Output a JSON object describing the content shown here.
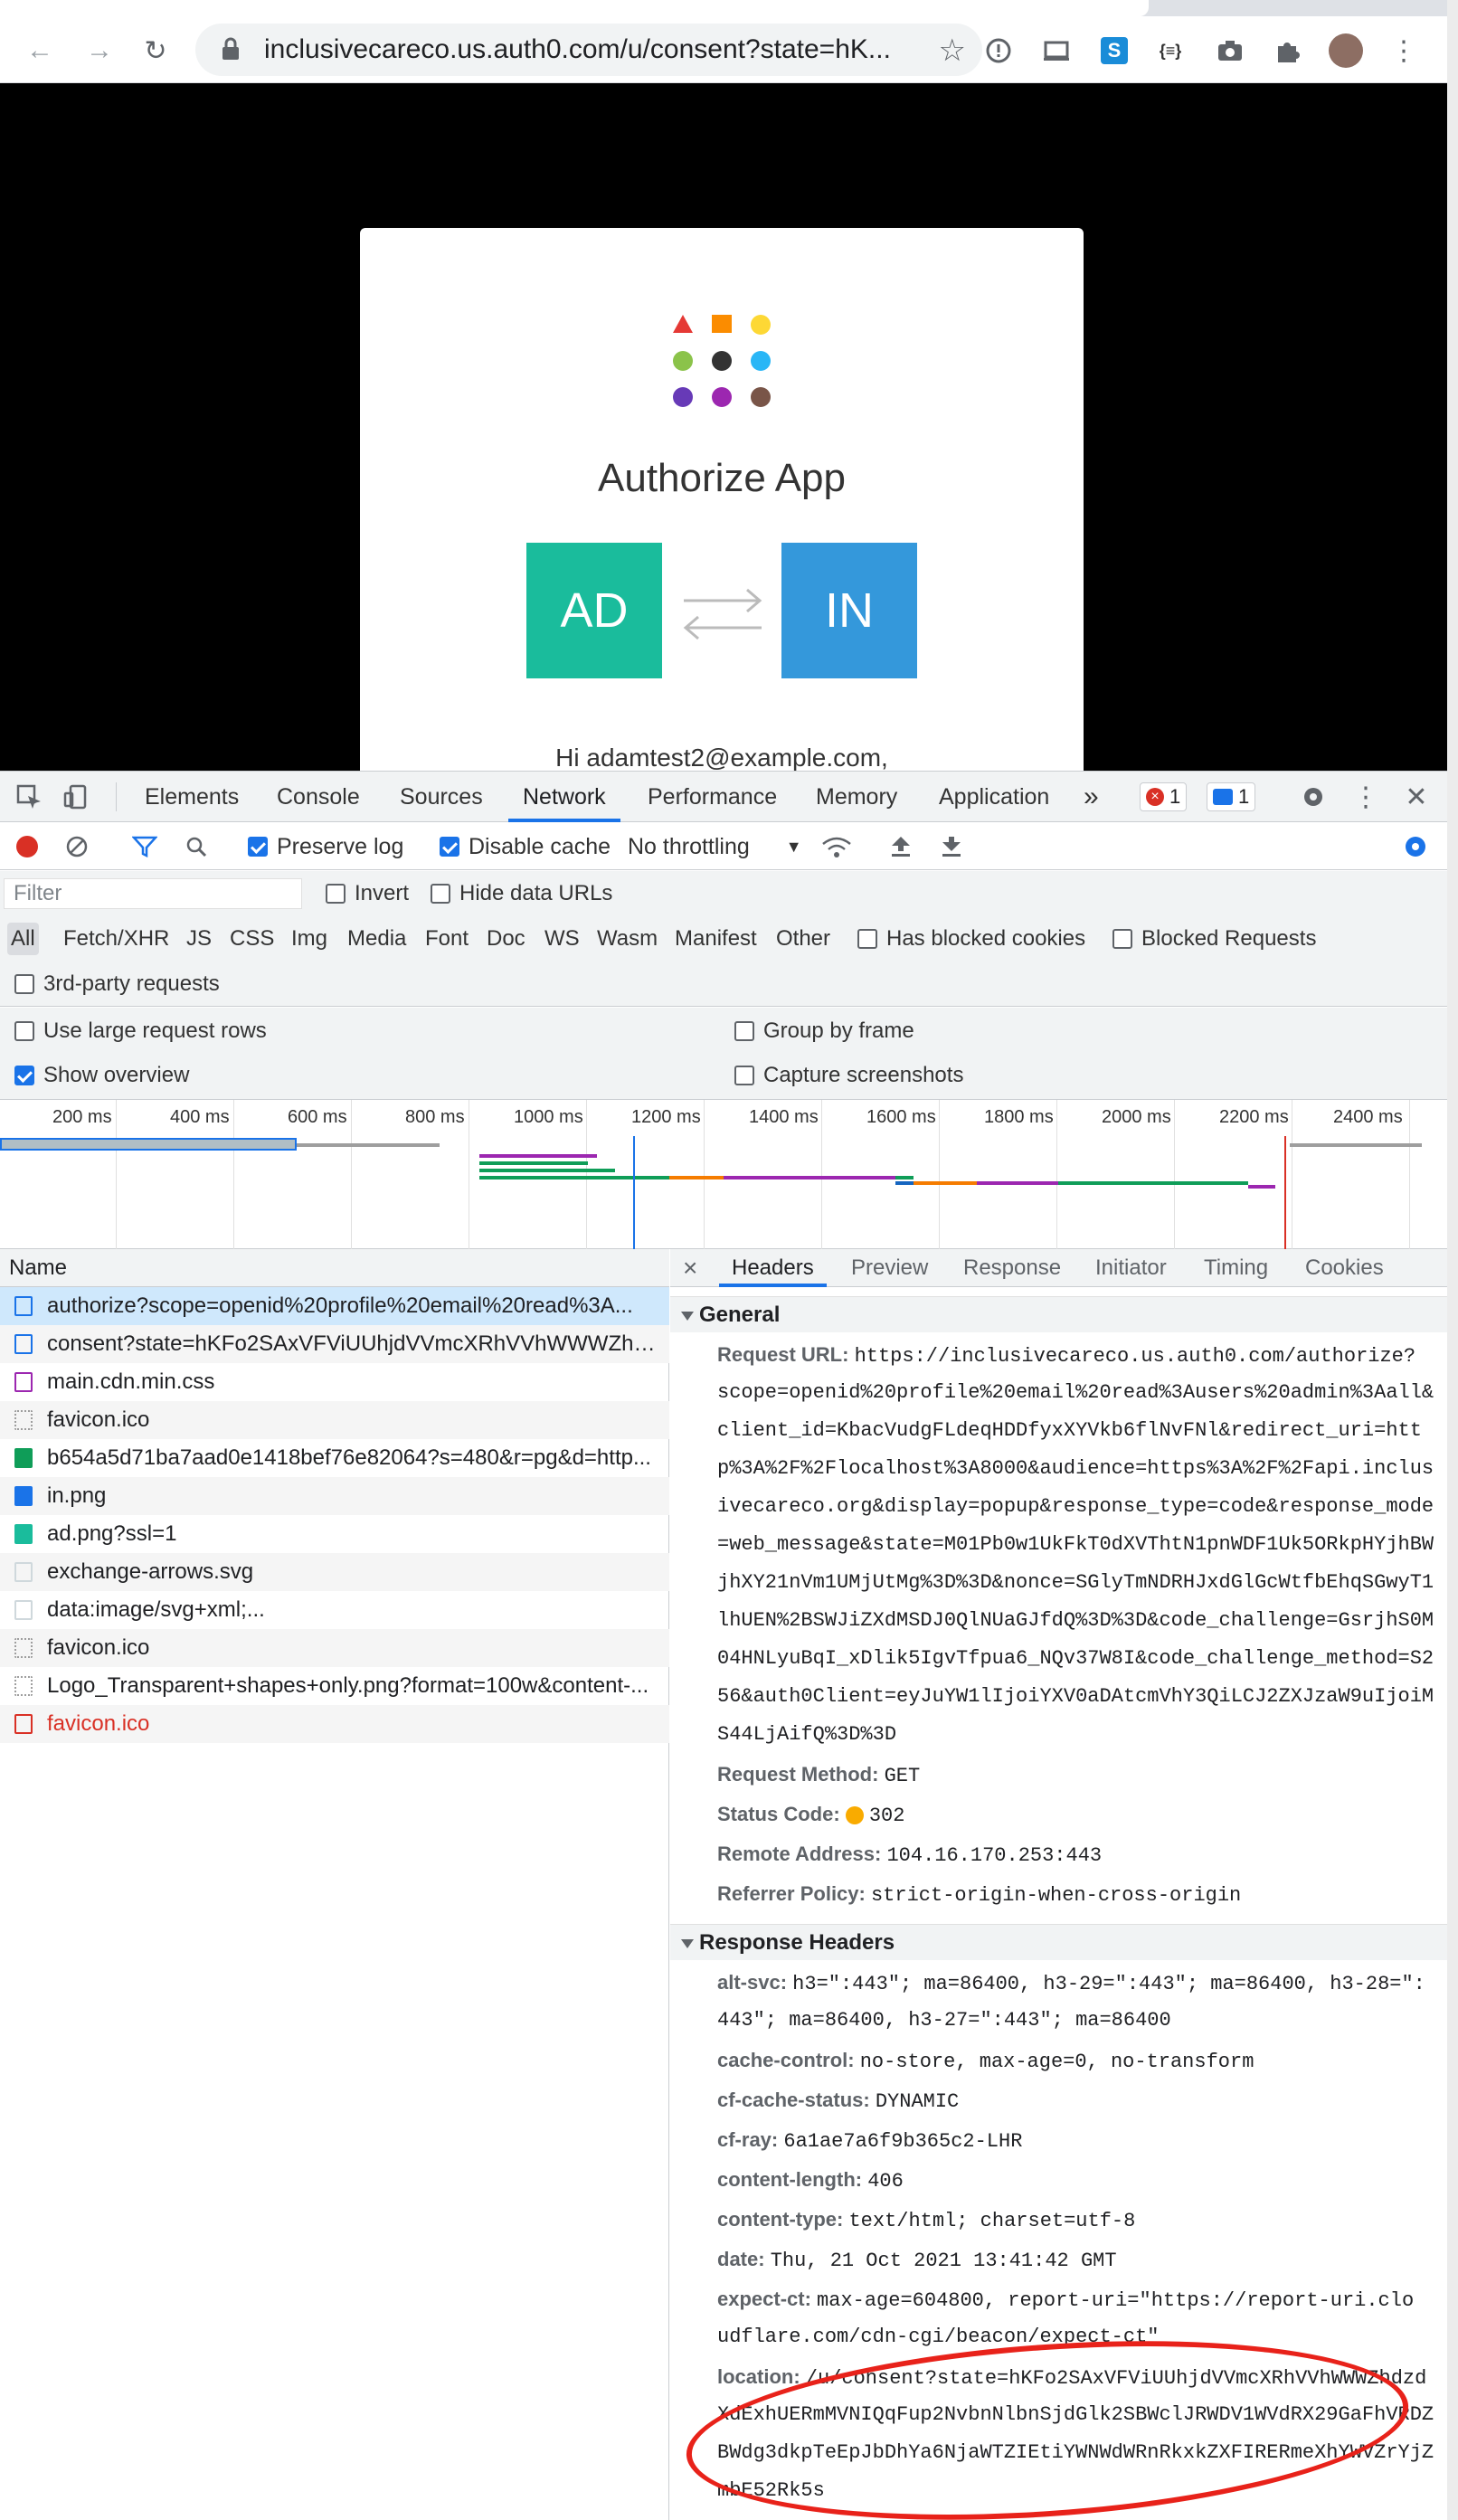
{
  "browser": {
    "url": "inclusivecareco.us.auth0.com/u/consent?state=hK...",
    "ext_label": "{≡}"
  },
  "page": {
    "title": "Authorize App",
    "tile_left": "AD",
    "tile_right": "IN",
    "greeting": "Hi adamtest2@example.com,",
    "tile_left_color": "#1abc9c",
    "tile_right_color": "#3498db"
  },
  "devtools": {
    "tabs": [
      "Elements",
      "Console",
      "Sources",
      "Network",
      "Performance",
      "Memory",
      "Application"
    ],
    "active_tab": "Network",
    "more_tabs": "»",
    "error_count": "1",
    "message_count": "1",
    "toolbar": {
      "preserve_log": "Preserve log",
      "disable_cache": "Disable cache",
      "throttling": "No throttling"
    },
    "filter": {
      "placeholder": "Filter",
      "invert": "Invert",
      "hide_data_urls": "Hide data URLs",
      "types": [
        "All",
        "Fetch/XHR",
        "JS",
        "CSS",
        "Img",
        "Media",
        "Font",
        "Doc",
        "WS",
        "Wasm",
        "Manifest",
        "Other"
      ],
      "has_blocked_cookies": "Has blocked cookies",
      "blocked_requests": "Blocked Requests",
      "third_party": "3rd-party requests"
    },
    "options": {
      "large_rows": "Use large request rows",
      "group_by_frame": "Group by frame",
      "show_overview": "Show overview",
      "capture_screenshots": "Capture screenshots"
    },
    "timeline_ticks": [
      "200 ms",
      "400 ms",
      "600 ms",
      "800 ms",
      "1000 ms",
      "1200 ms",
      "1400 ms",
      "1600 ms",
      "1800 ms",
      "2000 ms",
      "2200 ms",
      "2400 ms"
    ],
    "list": {
      "header": "Name",
      "rows": [
        "authorize?scope=openid%20profile%20email%20read%3A...",
        "consent?state=hKFo2SAxVFViUUhjdVVmcXRhVVhWWWZhd...",
        "main.cdn.min.css",
        "favicon.ico",
        "b654a5d71ba7aad0e1418bef76e82064?s=480&r=pg&d=http...",
        "in.png",
        "ad.png?ssl=1",
        "exchange-arrows.svg",
        "data:image/svg+xml;...",
        "favicon.ico",
        "Logo_Transparent+shapes+only.png?format=100w&content-...",
        "favicon.ico"
      ]
    },
    "detail": {
      "close": "×",
      "tabs": [
        "Headers",
        "Preview",
        "Response",
        "Initiator",
        "Timing",
        "Cookies"
      ],
      "general_title": "General",
      "request_url_key": "Request URL:",
      "request_url_lines": [
        "https://inclusivecareco.us.auth0.com/authorize?",
        "scope=openid%20profile%20email%20read%3Ausers%20admin%3Aall&",
        "client_id=KbacVudgFLdeqHDDfyxXYVkb6flNvFNl&redirect_uri=htt",
        "p%3A%2F%2Flocalhost%3A8000&audience=https%3A%2F%2Fapi.inclus",
        "ivecareco.org&display=popup&response_type=code&response_mode",
        "=web_message&state=M01Pb0w1UkFkT0dXVThtN1pnWDF1Uk5ORkpHYjhBW",
        "jhXY21nVm1UMjUtMg%3D%3D&nonce=SGlyTmNDRHJxdGlGcWtfbEhqSGwyT1",
        "lhUEN%2BSWJiZXdMSDJ0QlNUaGJfdQ%3D%3D&code_challenge=GsrjhS0M",
        "04HNLyuBqI_xDlik5IgvTfpua6_NQv37W8I&code_challenge_method=S2",
        "56&auth0Client=eyJuYW1lIjoiYXV0aDAtcmVhY3QiLCJ2ZXJzaW9uIjoiM",
        "S44LjAifQ%3D%3D"
      ],
      "request_method_key": "Request Method:",
      "request_method": "GET",
      "status_key": "Status Code:",
      "status": "302",
      "remote_key": "Remote Address:",
      "remote": "104.16.170.253:443",
      "referrer_key": "Referrer Policy:",
      "referrer": "strict-origin-when-cross-origin",
      "response_title": "Response Headers",
      "alt_svc_key": "alt-svc:",
      "alt_svc_1": "h3=\":443\"; ma=86400, h3-29=\":443\"; ma=86400, h3-28=\":",
      "alt_svc_2": "443\"; ma=86400, h3-27=\":443\"; ma=86400",
      "cache_control_key": "cache-control:",
      "cache_control": "no-store, max-age=0, no-transform",
      "cf_cache_key": "cf-cache-status:",
      "cf_cache": "DYNAMIC",
      "cf_ray_key": "cf-ray:",
      "cf_ray": "6a1ae7a6f9b365c2-LHR",
      "content_length_key": "content-length:",
      "content_length": "406",
      "content_type_key": "content-type:",
      "content_type": "text/html; charset=utf-8",
      "date_key": "date:",
      "date": "Thu, 21 Oct 2021 13:41:42 GMT",
      "expect_ct_key": "expect-ct:",
      "expect_ct_1": "max-age=604800, report-uri=\"https://report-uri.clo",
      "expect_ct_2": "udflare.com/cdn-cgi/beacon/expect-ct\"",
      "location_key": "location:",
      "location_1": "/u/consent?state=hKFo2SAxVFViUUhjdVVmcXRhVVhWWWZhdzd",
      "location_2": "XdExhUERmMVNIQqFup2NvbnNlbnSjdGlk2SBWclJRWDV1WVdRX29GaFhVRDZ",
      "location_3": "BWdg3dkpTeEpJbDhYa6NjaWTZIEtiYWNWdWRnRkxkZXFIRERmeXhYWVZrYjZ",
      "location_4": "mbE52Rk5s"
    }
  },
  "colors": {
    "accent": "#1a73e8",
    "highlight": "#e8221a"
  }
}
